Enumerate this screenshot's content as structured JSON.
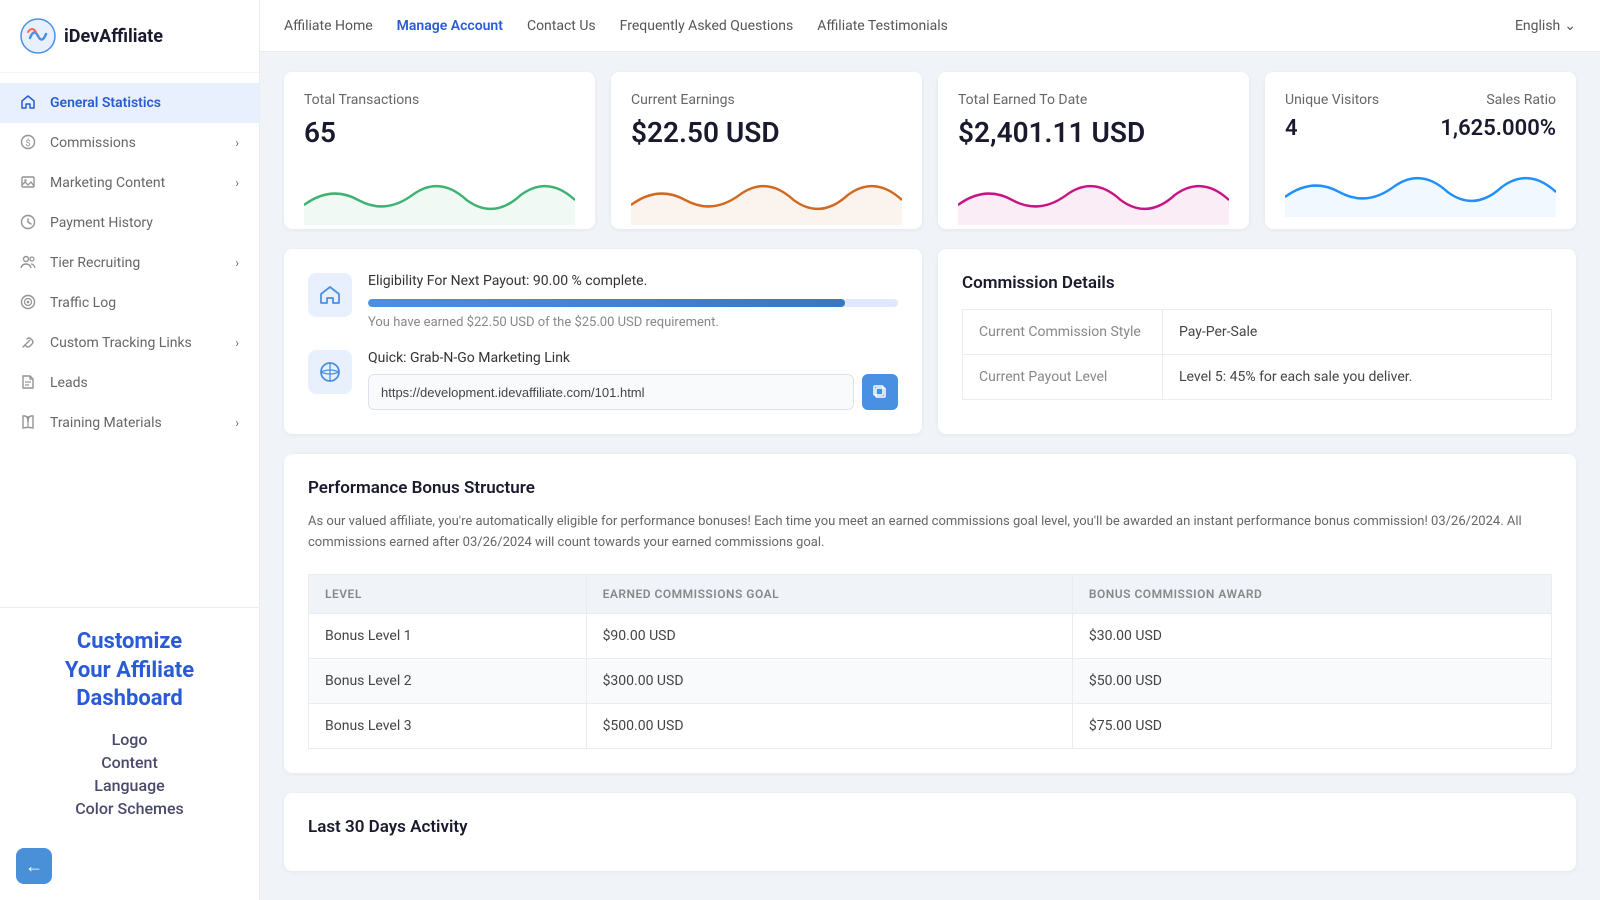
{
  "app": {
    "name": "iDevAffiliate",
    "logo_alt": "iDevAffiliate Logo"
  },
  "topnav": {
    "links": [
      {
        "id": "affiliate-home",
        "label": "Affiliate Home",
        "active": false
      },
      {
        "id": "manage-account",
        "label": "Manage Account",
        "active": true
      },
      {
        "id": "contact-us",
        "label": "Contact Us",
        "active": false
      },
      {
        "id": "faq",
        "label": "Frequently Asked Questions",
        "active": false
      },
      {
        "id": "testimonials",
        "label": "Affiliate Testimonials",
        "active": false
      }
    ],
    "language": "English"
  },
  "sidebar": {
    "items": [
      {
        "id": "general-statistics",
        "label": "General Statistics",
        "icon": "home",
        "active": true,
        "has_sub": false
      },
      {
        "id": "commissions",
        "label": "Commissions",
        "icon": "dollar",
        "active": false,
        "has_sub": true
      },
      {
        "id": "marketing-content",
        "label": "Marketing Content",
        "icon": "image",
        "active": false,
        "has_sub": true
      },
      {
        "id": "payment-history",
        "label": "Payment History",
        "icon": "clock",
        "active": false,
        "has_sub": false
      },
      {
        "id": "tier-recruiting",
        "label": "Tier Recruiting",
        "icon": "users",
        "active": false,
        "has_sub": true
      },
      {
        "id": "traffic-log",
        "label": "Traffic Log",
        "icon": "target",
        "active": false,
        "has_sub": false
      },
      {
        "id": "custom-tracking-links",
        "label": "Custom Tracking Links",
        "icon": "link",
        "active": false,
        "has_sub": true
      },
      {
        "id": "leads",
        "label": "Leads",
        "icon": "file",
        "active": false,
        "has_sub": false
      },
      {
        "id": "training-materials",
        "label": "Training Materials",
        "icon": "book",
        "active": false,
        "has_sub": true
      }
    ],
    "customize": {
      "title": "Customize\nYour Affiliate\nDashboard",
      "links": [
        "Logo",
        "Content",
        "Language",
        "Color Schemes"
      ]
    }
  },
  "stats": [
    {
      "id": "total-transactions",
      "label": "Total Transactions",
      "value": "65",
      "chart_color": "#3cb371",
      "chart_fill": "rgba(60,179,113,0.2)"
    },
    {
      "id": "current-earnings",
      "label": "Current Earnings",
      "value": "$22.50 USD",
      "chart_color": "#d2691e",
      "chart_fill": "rgba(210,105,30,0.2)"
    },
    {
      "id": "total-earned",
      "label": "Total Earned To Date",
      "value": "$2,401.11 USD",
      "chart_color": "#c71585",
      "chart_fill": "rgba(199,21,133,0.2)"
    },
    {
      "id": "unique-visitors-sales",
      "label1": "Unique Visitors",
      "value1": "4",
      "label2": "Sales Ratio",
      "value2": "1,625.000%",
      "chart_color": "#1e90ff",
      "chart_fill": "rgba(30,144,255,0.15)",
      "dual": true
    }
  ],
  "payout": {
    "eligibility_text": "Eligibility For Next Payout: 90.00 % complete.",
    "progress": 90,
    "earned_text": "You have earned $22.50 USD of the $25.00 USD requirement.",
    "marketing_link_label": "Quick: Grab-N-Go Marketing Link",
    "marketing_link_url": "https://development.idevaffiliate.com/101.html"
  },
  "commission_details": {
    "title": "Commission Details",
    "rows": [
      {
        "label": "Current Commission Style",
        "value": "Pay-Per-Sale"
      },
      {
        "label": "Current Payout Level",
        "value": "Level 5: 45% for each sale you deliver."
      }
    ]
  },
  "performance_bonus": {
    "title": "Performance Bonus Structure",
    "description": "As our valued affiliate, you're automatically eligible for performance bonuses! Each time you meet an earned commissions goal level, you'll be awarded an instant performance bonus commission! 03/26/2024. All commissions earned after 03/26/2024 will count towards your earned commissions goal.",
    "columns": [
      "LEVEL",
      "EARNED COMMISSIONS GOAL",
      "BONUS COMMISSION AWARD"
    ],
    "rows": [
      {
        "level": "Bonus Level 1",
        "goal": "$90.00 USD",
        "award": "$30.00 USD"
      },
      {
        "level": "Bonus Level 2",
        "goal": "$300.00 USD",
        "award": "$50.00 USD"
      },
      {
        "level": "Bonus Level 3",
        "goal": "$500.00 USD",
        "award": "$75.00 USD"
      }
    ]
  },
  "last30": {
    "title": "Last 30 Days Activity"
  }
}
